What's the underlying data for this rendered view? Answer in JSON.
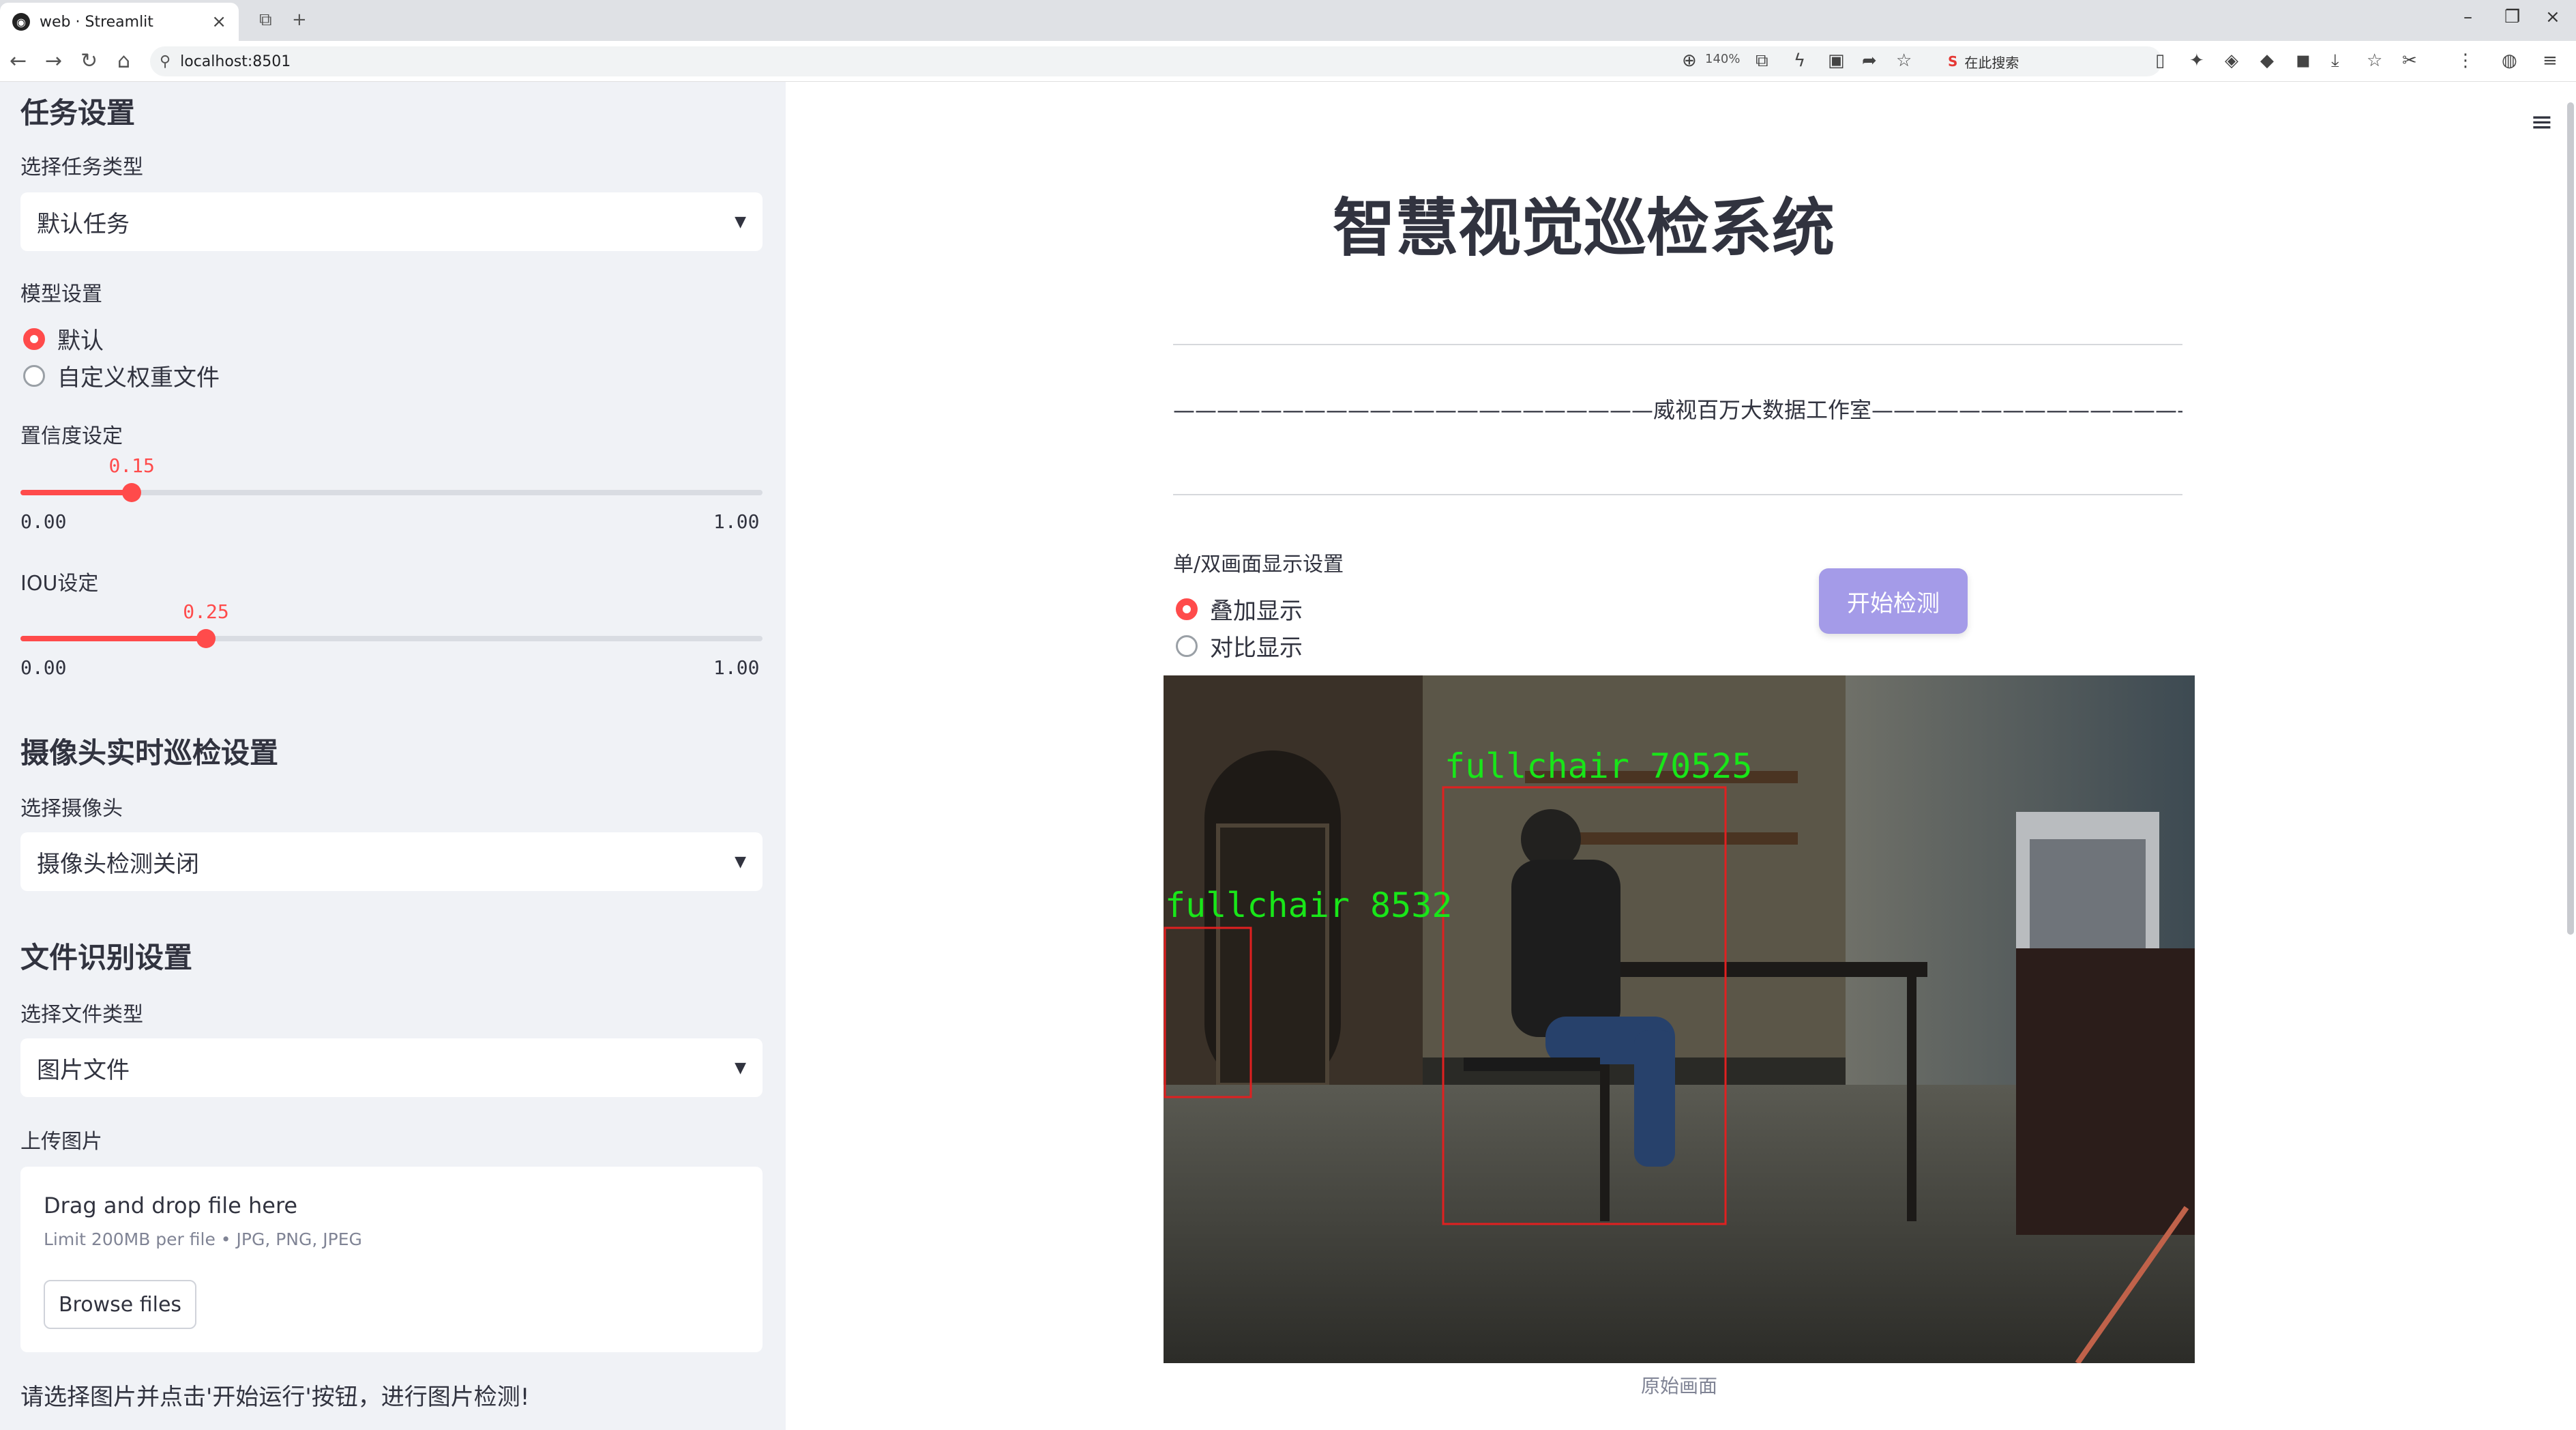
{
  "browser": {
    "tab_title": "web · Streamlit",
    "url": "localhost:8501",
    "zoom": "140%",
    "search_placeholder": "在此搜索"
  },
  "sidebar": {
    "task_section_title": "任务设置",
    "task_type_label": "选择任务类型",
    "task_type_value": "默认任务",
    "model_label": "模型设置",
    "model_options": [
      "默认",
      "自定义权重文件"
    ],
    "model_selected": "默认",
    "confidence": {
      "label": "置信度设定",
      "value": 0.15,
      "value_text": "0.15",
      "min_text": "0.00",
      "max_text": "1.00"
    },
    "iou": {
      "label": "IOU设定",
      "value": 0.25,
      "value_text": "0.25",
      "min_text": "0.00",
      "max_text": "1.00"
    },
    "camera_section_title": "摄像头实时巡检设置",
    "camera_label": "选择摄像头",
    "camera_value": "摄像头检测关闭",
    "file_section_title": "文件识别设置",
    "file_type_label": "选择文件类型",
    "file_type_value": "图片文件",
    "upload_label": "上传图片",
    "upload_drag_text": "Drag and drop file here",
    "upload_limit_text": "Limit 200MB per file • JPG, PNG, JPEG",
    "browse_button": "Browse files",
    "note": "请选择图片并点击'开始运行'按钮，进行图片检测!"
  },
  "main": {
    "title": "智慧视觉巡检系统",
    "studio_line": "——————————————————————威视百万大数据工作室———————————————————————",
    "display_label": "单/双画面显示设置",
    "display_options": [
      "叠加显示",
      "对比显示"
    ],
    "display_selected": "叠加显示",
    "start_button": "开始检测",
    "detections": [
      {
        "label": "fullchair 70525"
      },
      {
        "label": "fullchair 8532"
      }
    ],
    "image_caption": "原始画面"
  },
  "colors": {
    "accent": "#ff4b4b",
    "sidebar_bg": "#f0f2f6",
    "button_bg": "#a49be8",
    "box_red": "#e02020",
    "label_green": "#19e619"
  }
}
